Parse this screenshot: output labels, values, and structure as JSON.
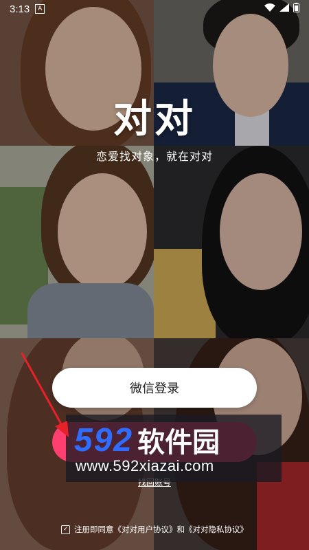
{
  "status_bar": {
    "time": "3:13",
    "notification_badge": "A"
  },
  "app": {
    "title": "对对",
    "slogan": "恋爱找对象，就在对对"
  },
  "actions": {
    "wechat_login_label": "微信登录",
    "find_account_label": "找回账号"
  },
  "agreement": {
    "checked": true,
    "text": "注册即同意《对对用户协议》和《对对隐私协议》"
  },
  "watermark": {
    "logo_number": "592",
    "logo_text": "软件园",
    "url": "www.592xiazai.com"
  },
  "colors": {
    "accent": "#ff3f6f",
    "watermark_blue": "#2f6dff",
    "arrow_red": "#e8202a"
  }
}
